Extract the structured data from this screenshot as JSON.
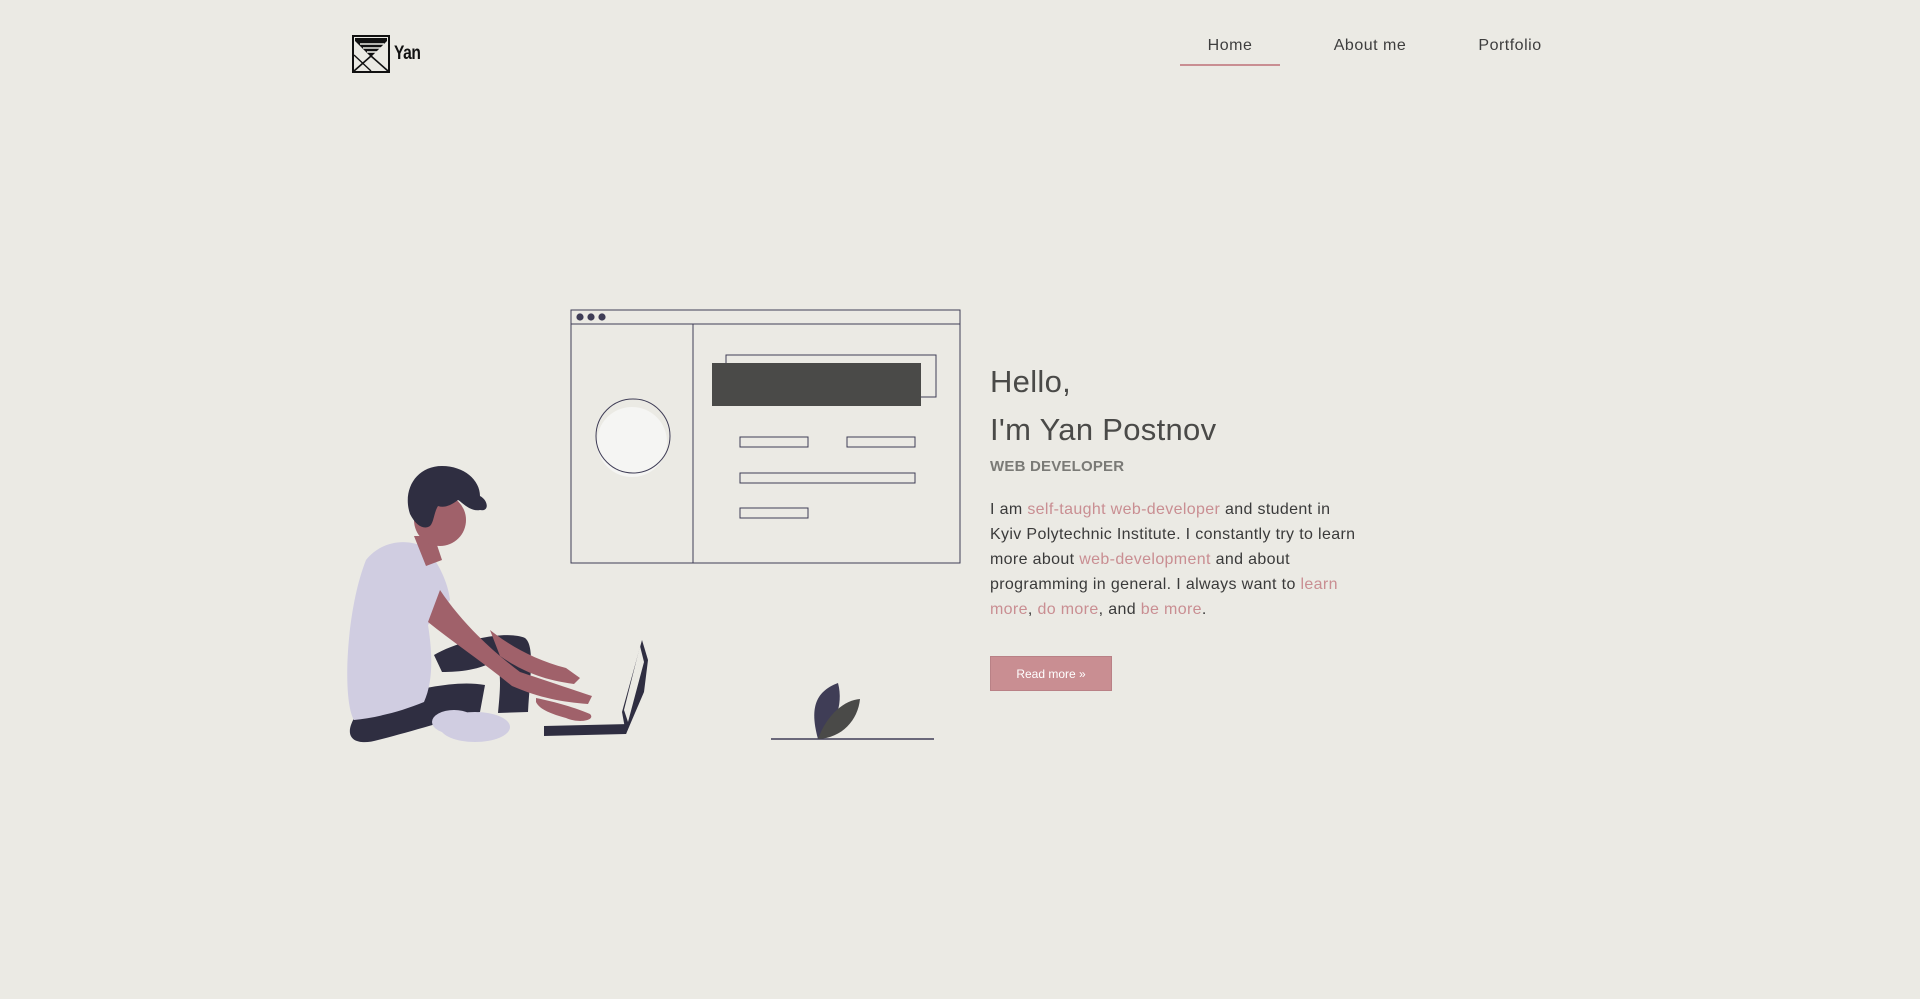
{
  "header": {
    "logo_text": "Yan",
    "nav": [
      {
        "label": "Home",
        "active": true
      },
      {
        "label": "About me",
        "active": false
      },
      {
        "label": "Portfolio",
        "active": false
      }
    ]
  },
  "hero": {
    "greeting": "Hello,",
    "name": "I'm Yan Postnov",
    "role": "WEB DEVELOPER",
    "about": {
      "t1": "I am ",
      "h1": "self-taught web-developer",
      "t2": " and student in Kyiv Polytechnic Institute. I constantly try to learn more about ",
      "h2": "web-development",
      "t3": " and about programming in general. I always want to ",
      "h3": "learn more",
      "t4": ", ",
      "h4": "do more",
      "t5": ", and ",
      "h5": "be more",
      "t6": "."
    },
    "cta_label": "Read more »"
  },
  "colors": {
    "background": "#EBEAE4",
    "accent": "#C98E92",
    "heading": "#4A4A48",
    "dark_figure": "#2F2E41",
    "skin": "#A0616A",
    "shirt": "#D0CDE1"
  },
  "icons": {
    "logo": "envelope-triangle-logo-icon",
    "window_dots": "window-control-dots-icon",
    "plant": "leaf-plant-icon"
  }
}
